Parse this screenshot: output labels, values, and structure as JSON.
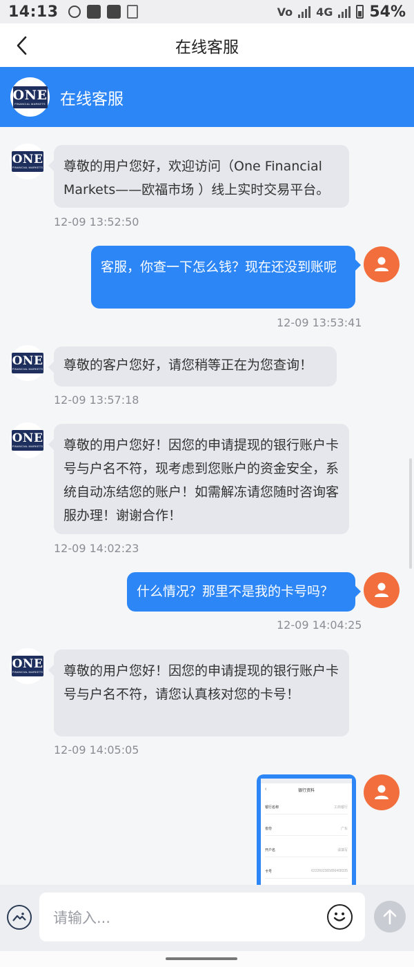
{
  "status_bar": {
    "time": "14:13",
    "network": "4G",
    "volte": "Vo",
    "battery": "54%"
  },
  "titlebar": {
    "title": "在线客服"
  },
  "service_header": {
    "title": "在线客服",
    "logo_text": "ONE",
    "logo_subtext": "FINANCIAL MARKETS"
  },
  "messages": [
    {
      "side": "agent",
      "text": "尊敬的用户您好，欢迎访问（One Financial Markets——欧福市场 ）线上实时交易平台。",
      "time": "12-09 13:52:50"
    },
    {
      "side": "user",
      "text": "客服，你查一下怎么钱？现在还没到账呢",
      "time": "12-09 13:53:41"
    },
    {
      "side": "agent",
      "text": "尊敬的客户您好，请您稍等正在为您查询！",
      "time": "12-09 13:57:18"
    },
    {
      "side": "agent",
      "text": "尊敬的用户您好！因您的申请提现的银行账户卡号与户名不符，现考虑到您账户的资金安全，系统自动冻结您的账户！如需解冻请您随时咨询客服办理！谢谢合作！",
      "time": "12-09 14:02:23"
    },
    {
      "side": "user",
      "text": "什么情况？那里不是我的卡号吗？",
      "time": "12-09 14:04:25"
    },
    {
      "side": "agent",
      "text": "尊敬的用户您好！因您的申请提现的银行账户卡号与户名不符，请您认真核对您的卡号！",
      "time": "12-09 14:05:05"
    },
    {
      "side": "user",
      "type": "image"
    }
  ],
  "image_message": {
    "title": "银行资料",
    "rows": [
      {
        "label": "银行名称",
        "value": "工商银行"
      },
      {
        "label": "省份",
        "value": "广东"
      },
      {
        "label": "开户名",
        "value": "请填写"
      },
      {
        "label": "卡号",
        "value": "6222602365856408335"
      }
    ]
  },
  "input": {
    "placeholder": "请输入..."
  },
  "colors": {
    "primary": "#2c86f5",
    "user_avatar": "#f26f3d",
    "agent_bubble": "#e6e7ec"
  },
  "icons": [
    "back-arrow-icon",
    "image-icon",
    "emoji-icon",
    "send-arrow-icon",
    "user-icon"
  ]
}
